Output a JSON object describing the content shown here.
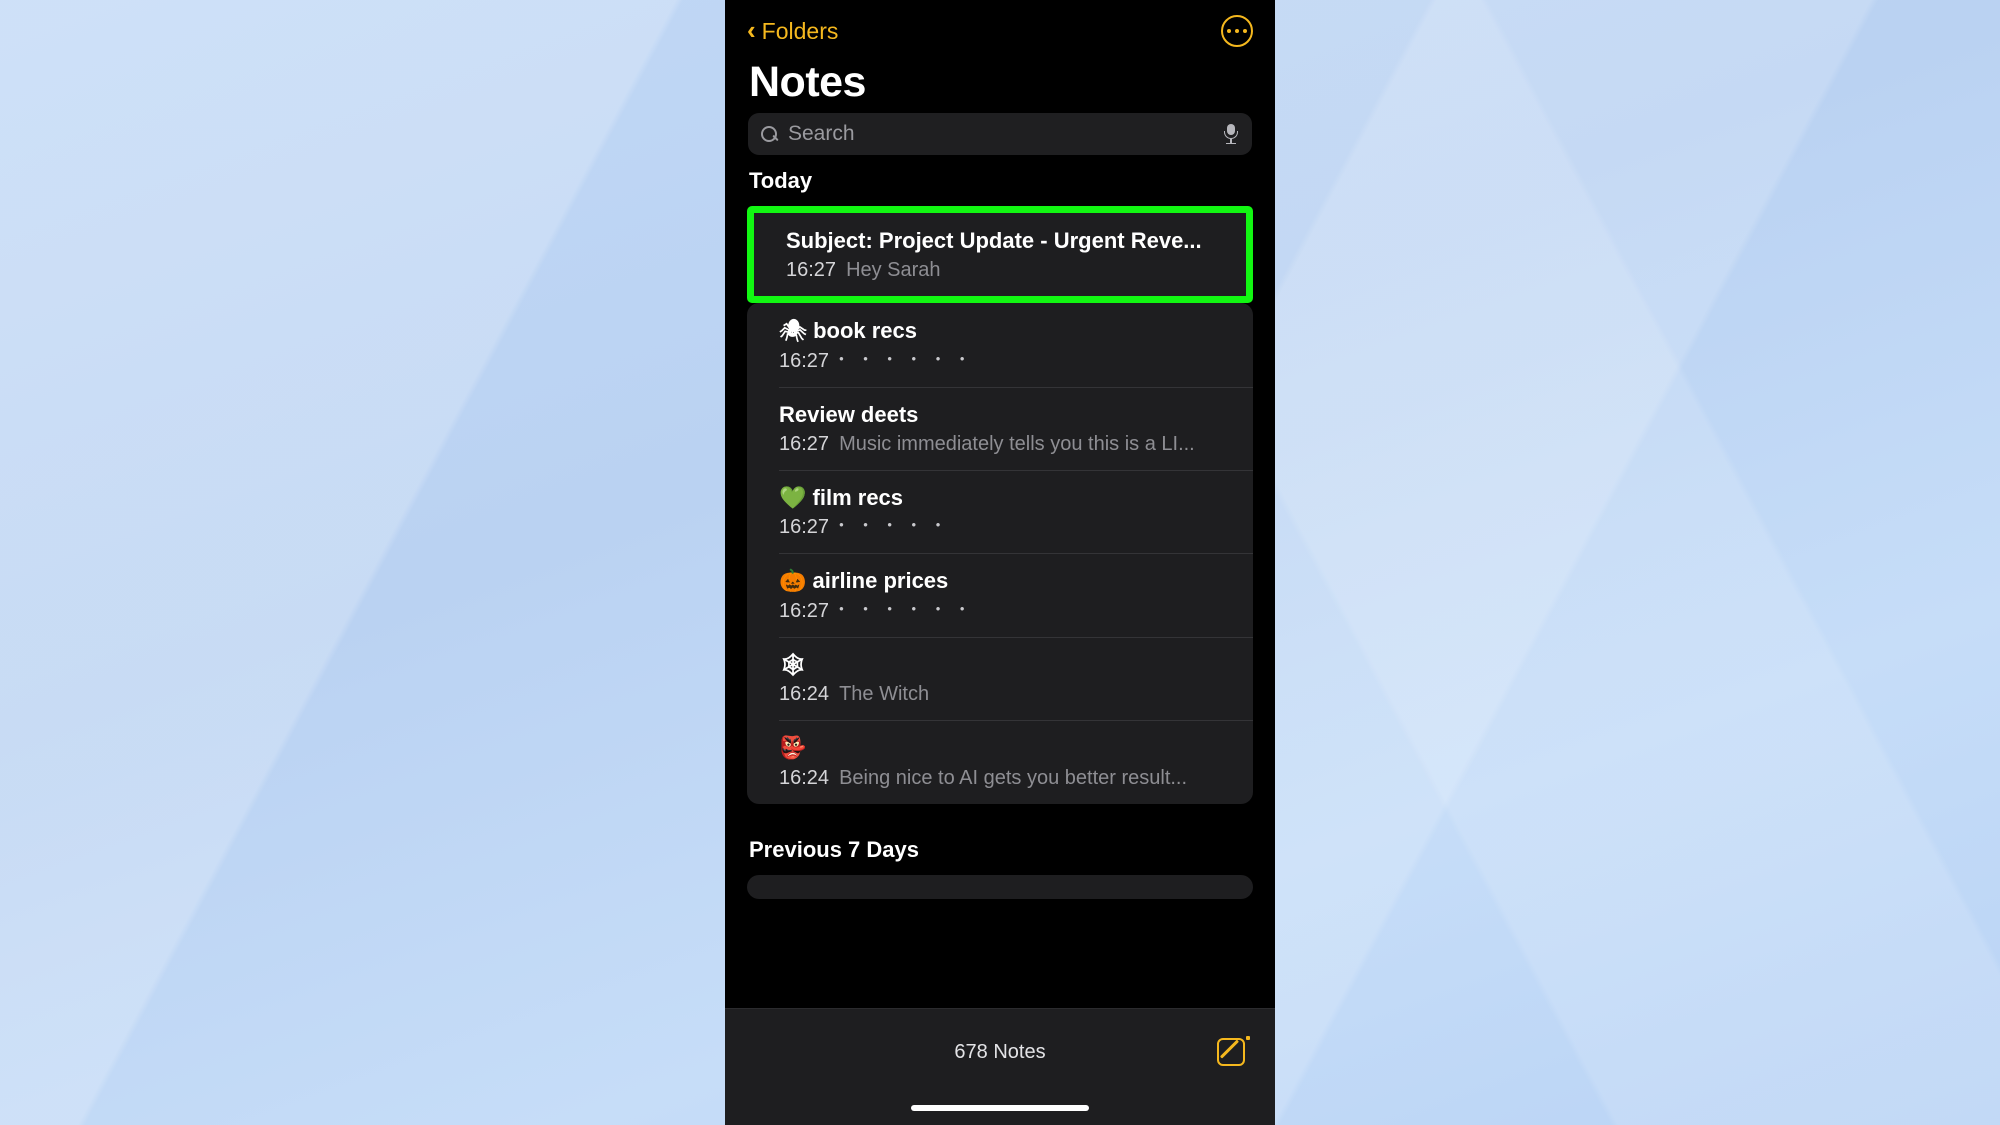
{
  "app": {
    "name": "Notes",
    "accent_color": "#f5b81e",
    "highlight_color": "#12f712",
    "background_color": "#000000",
    "card_color": "#1e1e20"
  },
  "navbar": {
    "back_label": "Folders",
    "back_icon": "chevron-left-icon",
    "more_icon": "ellipsis-circle-icon"
  },
  "header": {
    "title": "Notes"
  },
  "search": {
    "placeholder": "Search",
    "value": "",
    "search_icon": "search-icon",
    "mic_icon": "microphone-icon"
  },
  "sections": [
    {
      "label": "Today",
      "notes": [
        {
          "title": "Subject: Project Update - Urgent Reve...",
          "time": "16:27",
          "preview": "Hey Sarah",
          "emoji": "",
          "selected": true,
          "preview_is_dots": false
        },
        {
          "title": "book recs",
          "time": "16:27",
          "preview": "• • • • • •",
          "emoji": "🕷",
          "selected": false,
          "preview_is_dots": true
        },
        {
          "title": "Review deets",
          "time": "16:27",
          "preview": "Music immediately tells you this is a LI...",
          "emoji": "",
          "selected": false,
          "preview_is_dots": false
        },
        {
          "title": "film recs",
          "time": "16:27",
          "preview": "• • • • •",
          "emoji": "💚",
          "selected": false,
          "preview_is_dots": true
        },
        {
          "title": "airline prices",
          "time": "16:27",
          "preview": "• • • • • •",
          "emoji": "🎃",
          "selected": false,
          "preview_is_dots": true
        },
        {
          "title": "",
          "time": "16:24",
          "preview": "The Witch",
          "emoji": "🕸",
          "selected": false,
          "preview_is_dots": false
        },
        {
          "title": "",
          "time": "16:24",
          "preview": "Being nice to AI gets you better result...",
          "emoji": "👺",
          "selected": false,
          "preview_is_dots": false
        }
      ]
    },
    {
      "label": "Previous 7 Days",
      "notes": []
    }
  ],
  "toolbar": {
    "notes_count": "678 Notes",
    "compose_icon": "compose-note-icon"
  }
}
